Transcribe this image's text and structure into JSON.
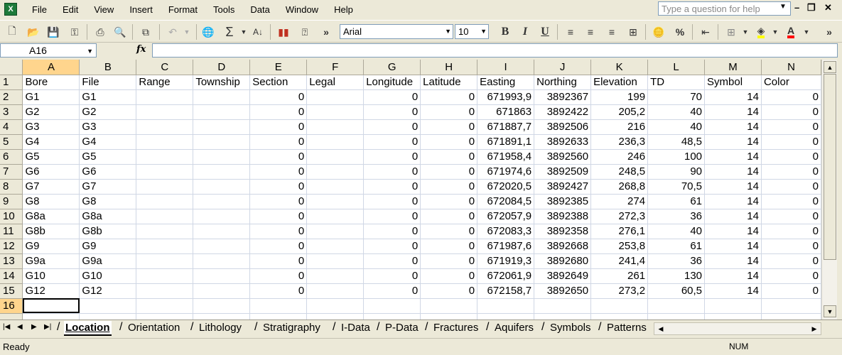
{
  "menu": {
    "app_icon": "X",
    "items": [
      "File",
      "Edit",
      "View",
      "Insert",
      "Format",
      "Tools",
      "Data",
      "Window",
      "Help"
    ],
    "question_placeholder": "Type a question for help"
  },
  "toolbar": {
    "font_name": "Arial",
    "font_size": "10",
    "icons": [
      "new-document-icon",
      "open-folder-icon",
      "save-icon",
      "permission-icon",
      "print-icon",
      "print-preview-icon",
      "copy-icon",
      "undo-icon",
      "hyperlink-icon",
      "autosum-icon",
      "sort-ascending-icon",
      "chart-wizard-icon",
      "help-icon",
      "more-options-icon",
      "bold-icon",
      "italic-icon",
      "underline-icon",
      "align-left-icon",
      "align-center-icon",
      "align-right-icon",
      "merge-center-icon",
      "currency-icon",
      "percent-icon",
      "decrease-indent-icon",
      "borders-icon",
      "fill-color-icon",
      "font-color-icon"
    ]
  },
  "formula_bar": {
    "cell_ref": "A16",
    "fx_label": "fx",
    "value": ""
  },
  "grid": {
    "columns": [
      "A",
      "B",
      "C",
      "D",
      "E",
      "F",
      "G",
      "H",
      "I",
      "J",
      "K",
      "L",
      "M",
      "N"
    ],
    "headers": [
      "Bore",
      "File",
      "Range",
      "Township",
      "Section",
      "Legal",
      "Longitude",
      "Latitude",
      "Easting",
      "Northing",
      "Elevation",
      "TD",
      "Symbol",
      "Color"
    ],
    "rows": [
      [
        "G1",
        "G1",
        "",
        "",
        "0",
        "",
        "0",
        "0",
        "671993,9",
        "3892367",
        "199",
        "70",
        "14",
        "0"
      ],
      [
        "G2",
        "G2",
        "",
        "",
        "0",
        "",
        "0",
        "0",
        "671863",
        "3892422",
        "205,2",
        "40",
        "14",
        "0"
      ],
      [
        "G3",
        "G3",
        "",
        "",
        "0",
        "",
        "0",
        "0",
        "671887,7",
        "3892506",
        "216",
        "40",
        "14",
        "0"
      ],
      [
        "G4",
        "G4",
        "",
        "",
        "0",
        "",
        "0",
        "0",
        "671891,1",
        "3892633",
        "236,3",
        "48,5",
        "14",
        "0"
      ],
      [
        "G5",
        "G5",
        "",
        "",
        "0",
        "",
        "0",
        "0",
        "671958,4",
        "3892560",
        "246",
        "100",
        "14",
        "0"
      ],
      [
        "G6",
        "G6",
        "",
        "",
        "0",
        "",
        "0",
        "0",
        "671974,6",
        "3892509",
        "248,5",
        "90",
        "14",
        "0"
      ],
      [
        "G7",
        "G7",
        "",
        "",
        "0",
        "",
        "0",
        "0",
        "672020,5",
        "3892427",
        "268,8",
        "70,5",
        "14",
        "0"
      ],
      [
        "G8",
        "G8",
        "",
        "",
        "0",
        "",
        "0",
        "0",
        "672084,5",
        "3892385",
        "274",
        "61",
        "14",
        "0"
      ],
      [
        "G8a",
        "G8a",
        "",
        "",
        "0",
        "",
        "0",
        "0",
        "672057,9",
        "3892388",
        "272,3",
        "36",
        "14",
        "0"
      ],
      [
        "G8b",
        "G8b",
        "",
        "",
        "0",
        "",
        "0",
        "0",
        "672083,3",
        "3892358",
        "276,1",
        "40",
        "14",
        "0"
      ],
      [
        "G9",
        "G9",
        "",
        "",
        "0",
        "",
        "0",
        "0",
        "671987,6",
        "3892668",
        "253,8",
        "61",
        "14",
        "0"
      ],
      [
        "G9a",
        "G9a",
        "",
        "",
        "0",
        "",
        "0",
        "0",
        "671919,3",
        "3892680",
        "241,4",
        "36",
        "14",
        "0"
      ],
      [
        "G10",
        "G10",
        "",
        "",
        "0",
        "",
        "0",
        "0",
        "672061,9",
        "3892649",
        "261",
        "130",
        "14",
        "0"
      ],
      [
        "G12",
        "G12",
        "",
        "",
        "0",
        "",
        "0",
        "0",
        "672158,7",
        "3892650",
        "273,2",
        "60,5",
        "14",
        "0"
      ]
    ],
    "numeric_columns": [
      4,
      6,
      7,
      8,
      9,
      10,
      11,
      12,
      13
    ],
    "active_cell": "A16",
    "selected_color": "#FFD58D"
  },
  "sheet_tabs": {
    "tabs": [
      "Location",
      "Orientation",
      "Lithology",
      "Stratigraphy",
      "I-Data",
      "P-Data",
      "Fractures",
      "Aquifers",
      "Symbols",
      "Patterns"
    ],
    "active": "Location"
  },
  "status_bar": {
    "left": "Ready",
    "right": "NUM"
  }
}
